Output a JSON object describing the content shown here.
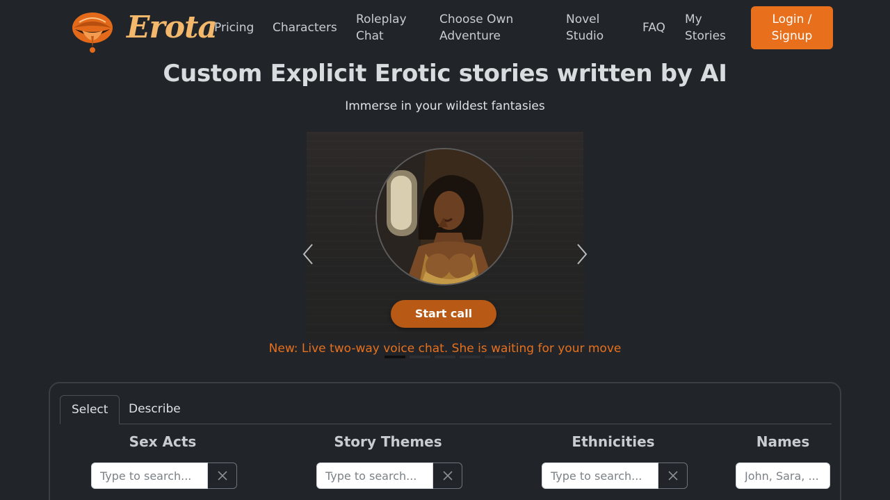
{
  "brand": {
    "name": "Erota"
  },
  "nav": {
    "links": [
      "Pricing",
      "Characters",
      "Roleplay Chat",
      "Choose Own Adventure",
      "Novel Studio",
      "FAQ",
      "My Stories"
    ],
    "login_label": "Login / Signup"
  },
  "hero": {
    "title": "Custom Explicit Erotic stories written by AI",
    "subtitle": "Immerse in your wildest fantasies"
  },
  "carousel": {
    "button_label": "Start call",
    "caption": "New: Live two-way voice chat. She is waiting for your move",
    "slide_count": 5,
    "active_index": 0
  },
  "form": {
    "tabs": [
      "Select",
      "Describe"
    ],
    "active_tab": "Select",
    "fields": [
      {
        "title": "Sex Acts",
        "placeholder": "Type to search..."
      },
      {
        "title": "Story Themes",
        "placeholder": "Type to search..."
      },
      {
        "title": "Ethnicities",
        "placeholder": "Type to search..."
      },
      {
        "title": "Names",
        "placeholder": "John, Sara, ..."
      }
    ]
  },
  "colors": {
    "accent": "#e8701c",
    "background": "#212529",
    "call_button": "#b85a16"
  },
  "icons": [
    "lips-logo-icon",
    "chevron-left-icon",
    "chevron-right-icon",
    "close-icon"
  ]
}
